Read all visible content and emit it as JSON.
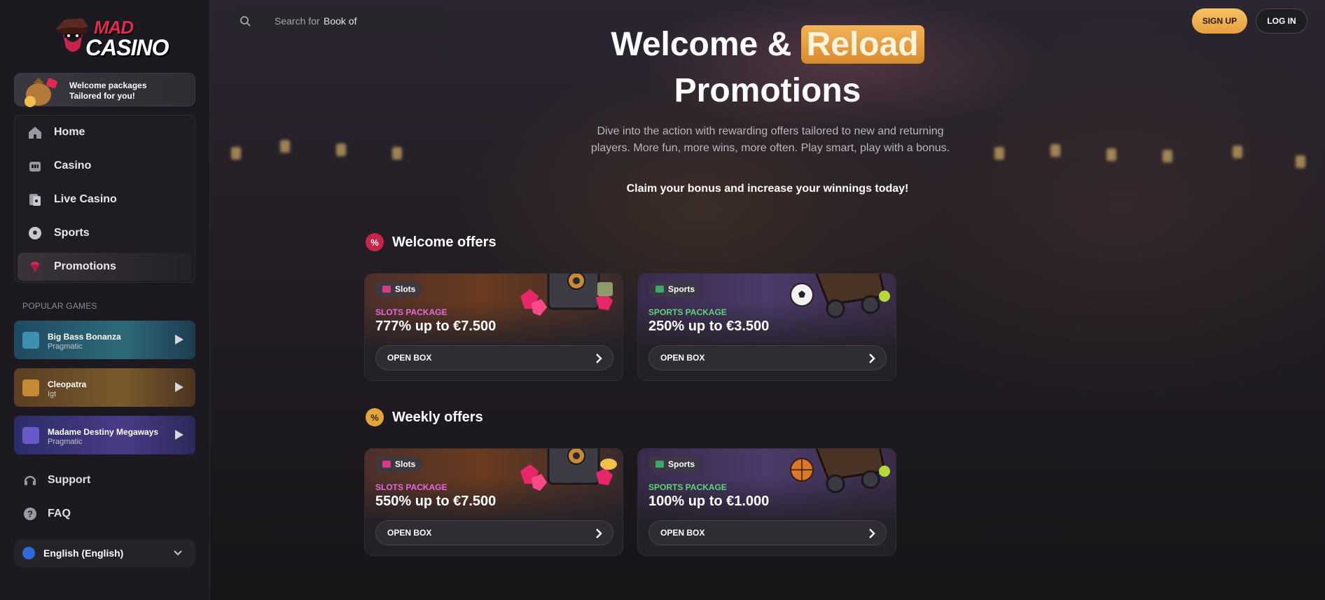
{
  "brand": {
    "logo_line1": "MAD",
    "logo_line2": "CASINO"
  },
  "welcome_box": {
    "line1": "Welcome packages",
    "line2": "Tailored for you!"
  },
  "nav": {
    "items": [
      {
        "label": "Home",
        "icon": "home-icon"
      },
      {
        "label": "Casino",
        "icon": "casino-icon"
      },
      {
        "label": "Live Casino",
        "icon": "live-casino-icon"
      },
      {
        "label": "Sports",
        "icon": "soccer-ball-icon"
      },
      {
        "label": "Promotions",
        "icon": "gem-icon",
        "active": true
      }
    ]
  },
  "popular": {
    "label": "POPULAR GAMES",
    "games": [
      {
        "name": "Big Bass Bonanza",
        "provider": "Pragmatic"
      },
      {
        "name": "Cleopatra",
        "provider": "Igt"
      },
      {
        "name": "Madame Destiny Megaways",
        "provider": "Pragmatic"
      }
    ]
  },
  "links": {
    "support": "Support",
    "faq": "FAQ"
  },
  "language": {
    "label": "English (English)"
  },
  "search": {
    "placeholder": "Search for",
    "value": "Book of"
  },
  "auth": {
    "signup": "SIGN UP",
    "login": "LOG IN"
  },
  "hero": {
    "title_part1": "Welcome &",
    "title_highlight": "Reload",
    "title_line2": "Promotions",
    "description": "Dive into the action with rewarding offers tailored to new and returning players. More fun, more wins, more often. Play smart, play with a bonus.",
    "cta": "Claim your bonus and increase your winnings today!"
  },
  "sections": {
    "welcome": {
      "title": "Welcome offers",
      "cards": [
        {
          "chip": "Slots",
          "kind": "SLOTS PACKAGE",
          "amount": "777% up to €7.500",
          "button": "OPEN BOX"
        },
        {
          "chip": "Sports",
          "kind": "SPORTS PACKAGE",
          "amount": "250% up to €3.500",
          "button": "OPEN BOX"
        }
      ]
    },
    "weekly": {
      "title": "Weekly offers",
      "cards": [
        {
          "chip": "Slots",
          "kind": "SLOTS PACKAGE",
          "amount": "550% up to €7.500",
          "button": "OPEN BOX"
        },
        {
          "chip": "Sports",
          "kind": "SPORTS PACKAGE",
          "amount": "100% up to €1.000",
          "button": "OPEN BOX"
        }
      ]
    }
  },
  "colors": {
    "accent_gold": "#f3b35a",
    "slots_pink": "#e86ad8",
    "sports_green": "#5fd47a",
    "brand_red": "#e3294f"
  }
}
